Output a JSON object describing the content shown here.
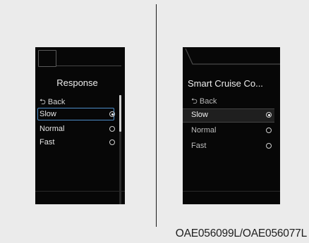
{
  "caption": "OAE056099L/OAE056077L",
  "screen_left": {
    "title": "Response",
    "back_label": "⮌ Back",
    "options": [
      {
        "label": "Slow",
        "selected": true
      },
      {
        "label": "Normal",
        "selected": false
      },
      {
        "label": "Fast",
        "selected": false
      }
    ]
  },
  "screen_right": {
    "title": "Smart Cruise Co...",
    "back_label": "⮌ Back",
    "options": [
      {
        "label": "Slow",
        "selected": true
      },
      {
        "label": "Normal",
        "selected": false
      },
      {
        "label": "Fast",
        "selected": false
      }
    ]
  }
}
